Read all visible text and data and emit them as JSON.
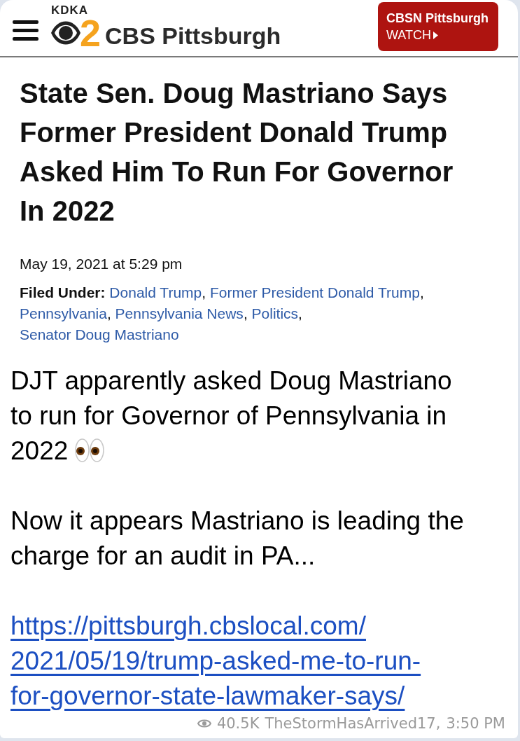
{
  "header": {
    "logo": {
      "station": "KDKA",
      "channel": "2",
      "name": "CBS Pittsburgh"
    },
    "watch_button": {
      "title": "CBSN Pittsburgh",
      "label": "WATCH"
    }
  },
  "article": {
    "headline": "State Sen. Doug Mastriano Says Former President Donald Trump Asked Him To Run For Governor In 2022",
    "date": "May 19, 2021 at 5:29 pm",
    "filed_under": {
      "label": "Filed Under:",
      "separator": ",",
      "tags": [
        "Donald Trump",
        "Former President Donald Trump",
        "Pennsylvania",
        "Pennsylvania News",
        "Politics",
        "Senator Doug Mastriano"
      ]
    }
  },
  "message": {
    "paragraphs": [
      "DJT apparently asked Doug Mastriano to run for Governor of Pennsylvania in 2022",
      "Now it appears Mastriano is leading the charge for an audit in PA..."
    ],
    "link": {
      "lines": [
        "https://pittsburgh.cbslocal.com/",
        "2021/05/19/trump-asked-me-to-run-",
        "for-governor-state-lawmaker-says/"
      ]
    }
  },
  "footer": {
    "views": "40.5K",
    "author": "TheStormHasArrived17,",
    "time": "3:50 PM"
  }
}
